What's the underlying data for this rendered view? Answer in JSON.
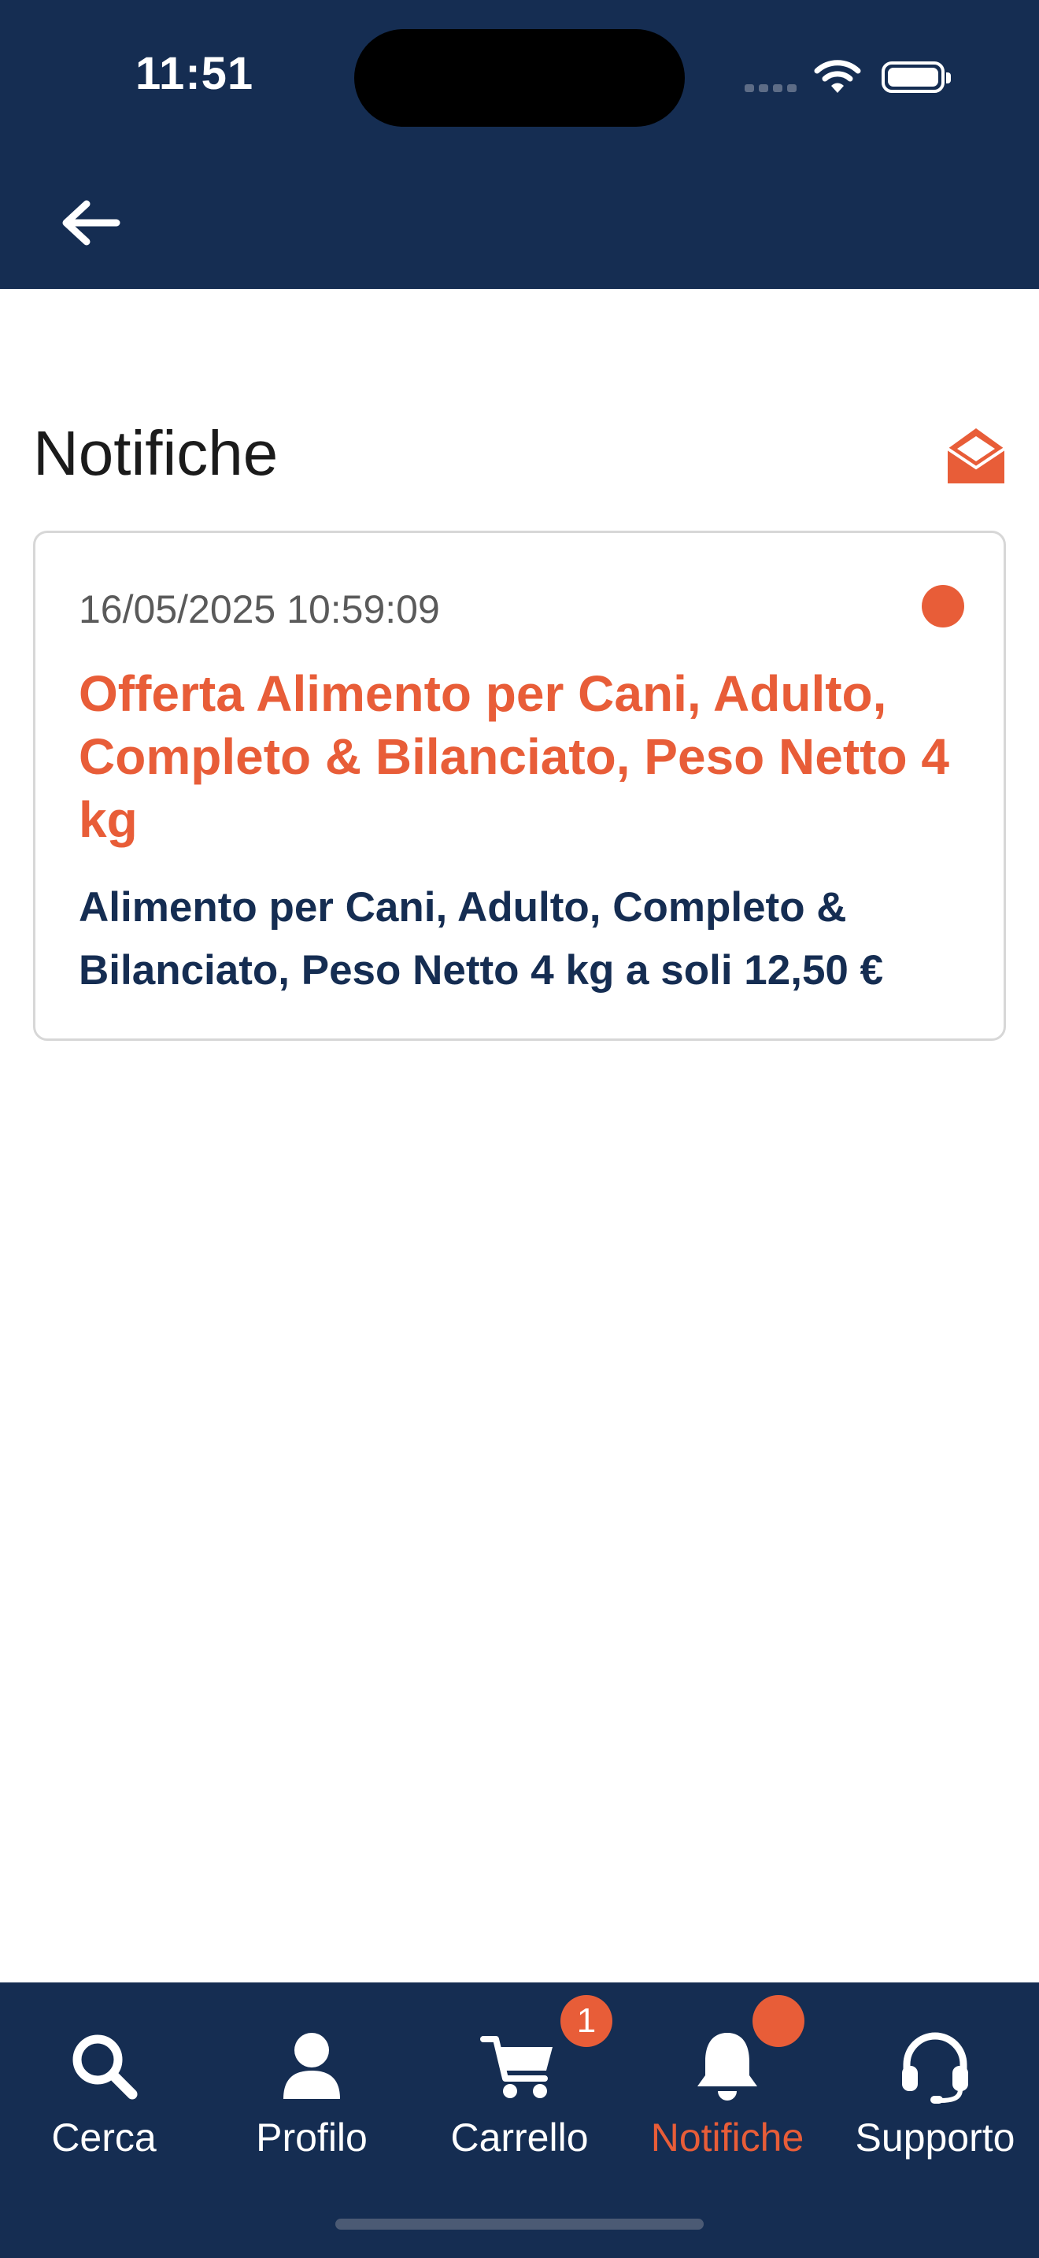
{
  "status_bar": {
    "time": "11:51"
  },
  "header": {
    "back_icon": "arrow-left-icon"
  },
  "page": {
    "title": "Notifiche",
    "mark_read_icon": "open-envelope-icon"
  },
  "notifications": [
    {
      "date": "16/05/2025 10:59:09",
      "title": "Offerta Alimento per Cani, Adulto, Completo & Bilanciato, Peso Netto 4 kg",
      "body": "Alimento per Cani, Adulto, Completo & Bilanciato, Peso Netto 4 kg a soli 12,50 €",
      "unread": true
    }
  ],
  "tabbar": {
    "items": [
      {
        "label": "Cerca",
        "icon": "search-icon"
      },
      {
        "label": "Profilo",
        "icon": "user-icon"
      },
      {
        "label": "Carrello",
        "icon": "cart-icon",
        "badge": "1"
      },
      {
        "label": "Notifiche",
        "icon": "bell-icon",
        "active": true
      },
      {
        "label": "Supporto",
        "icon": "headset-icon"
      }
    ]
  },
  "colors": {
    "navy": "#152d52",
    "accent": "#e85d38"
  }
}
